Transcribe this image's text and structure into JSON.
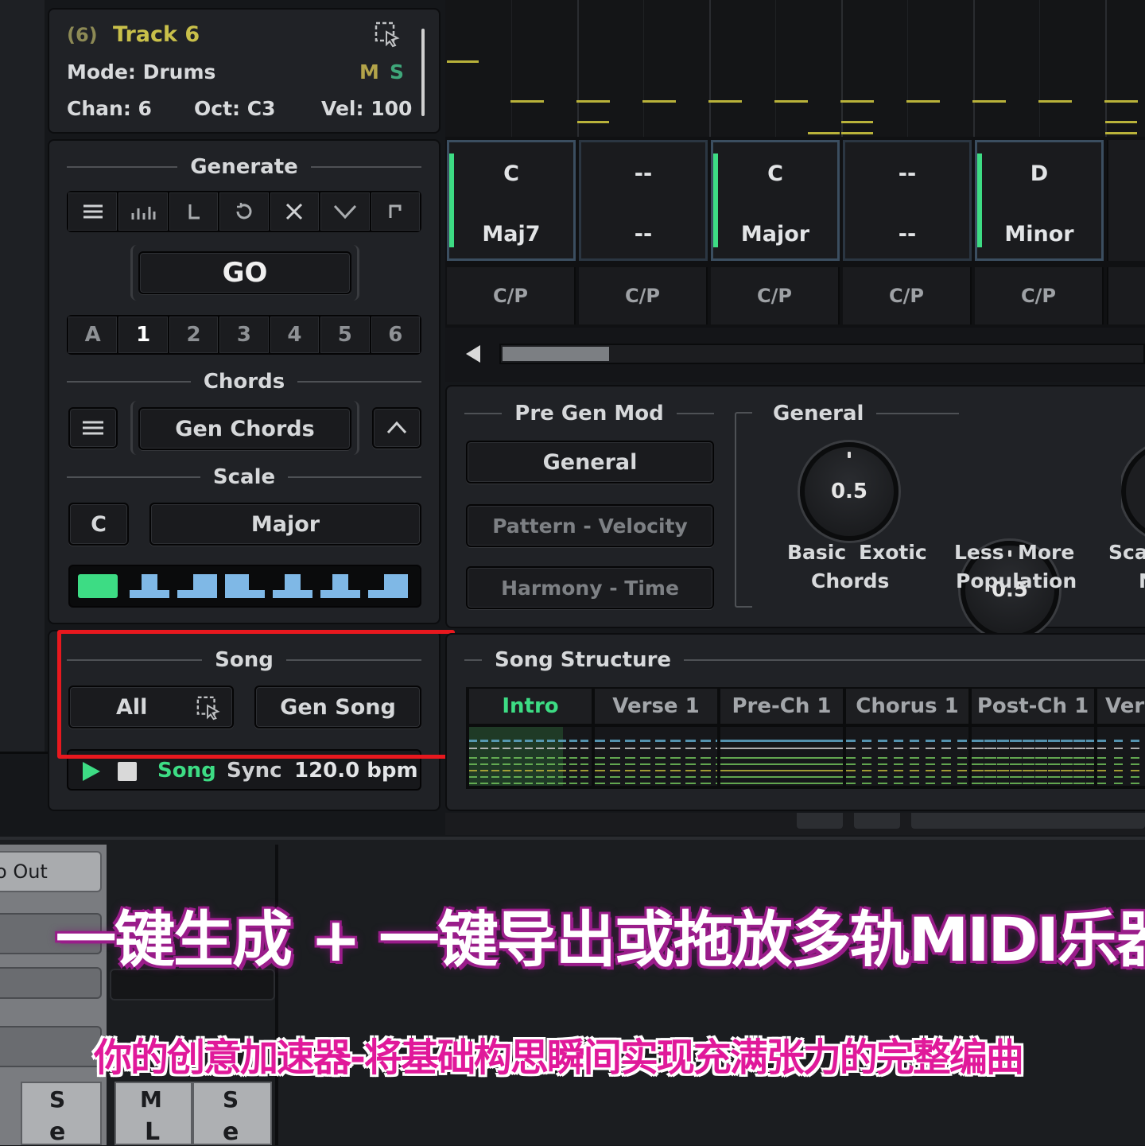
{
  "track": {
    "num": "(6)",
    "name": "Track 6",
    "mode": "Mode: Drums",
    "m": "M",
    "s": "S",
    "chan": "Chan: 6",
    "oct": "Oct: C3",
    "vel": "Vel: 100"
  },
  "generate": {
    "title": "Generate",
    "go": "GO",
    "variations": [
      "A",
      "1",
      "2",
      "3",
      "4",
      "5",
      "6"
    ]
  },
  "chords": {
    "title": "Chords",
    "gen": "Gen Chords"
  },
  "scale": {
    "title": "Scale",
    "root": "C",
    "type": "Major"
  },
  "song": {
    "title": "Song",
    "all": "All",
    "gen": "Gen Song",
    "state": "Song",
    "sync": "Sync",
    "bpm": "120.0 bpm"
  },
  "chord_slots": [
    {
      "root": "C",
      "quality": "Maj7",
      "cp": "C/P"
    },
    {
      "root": "--",
      "quality": "--",
      "cp": "C/P"
    },
    {
      "root": "C",
      "quality": "Major",
      "cp": "C/P"
    },
    {
      "root": "--",
      "quality": "--",
      "cp": "C/P"
    },
    {
      "root": "D",
      "quality": "Minor",
      "cp": "C/P"
    }
  ],
  "pregen": {
    "title": "Pre Gen Mod",
    "buttons": [
      "General",
      "Pattern - Velocity",
      "Harmony - Time"
    ]
  },
  "general": {
    "title": "General",
    "knobs": [
      {
        "value": "0.5",
        "left": "Basic",
        "right": "Exotic",
        "caption": "Chords"
      },
      {
        "value": "0.5",
        "left": "Less",
        "right": "More",
        "caption": "Population"
      }
    ],
    "third_partial": {
      "line1": "Scal",
      "line2": "N"
    }
  },
  "structure": {
    "title": "Song Structure",
    "sections": [
      "Intro",
      "Verse 1",
      "Pre-Ch 1",
      "Chorus 1",
      "Post-Ch 1",
      "Ver"
    ]
  },
  "daw": {
    "out": "o Out",
    "s": "S",
    "m": "M",
    "s2": "S",
    "e": "e",
    "l": "L",
    "e2": "e"
  },
  "banner": {
    "line1": "一键生成 + 一键导出或拖放多轨MIDI乐器",
    "line2": "你的创意加速器-将基础构思瞬间实现充满张力的完整编曲"
  },
  "colors": {
    "accent_green": "#3ddc84",
    "note_yellow": "#b9b23a",
    "highlight_red": "#e8181e",
    "scale_blue": "#7fb8e6"
  }
}
